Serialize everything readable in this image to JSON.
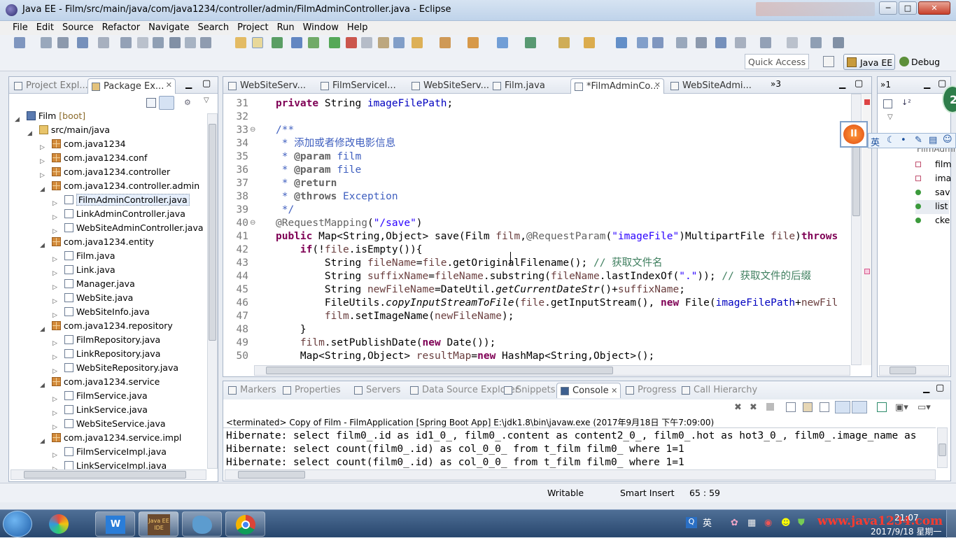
{
  "window": {
    "title": "Java EE - Film/src/main/java/com/java1234/controller/admin/FilmAdminController.java - Eclipse",
    "min": "─",
    "max": "□",
    "close": "✕"
  },
  "menu": [
    "File",
    "Edit",
    "Source",
    "Refactor",
    "Navigate",
    "Search",
    "Project",
    "Run",
    "Window",
    "Help"
  ],
  "quick_access": "Quick Access",
  "perspectives": {
    "javaee": "Java EE",
    "debug": "Debug"
  },
  "left_tabs": {
    "project": "Project Expl...",
    "package": "Package Ex..."
  },
  "tree": [
    {
      "label": "Film",
      "suffix": " [boot]",
      "indent": 0,
      "type": "project"
    },
    {
      "label": "src/main/java",
      "indent": 1,
      "type": "folder"
    },
    {
      "label": "com.java1234",
      "indent": 2,
      "type": "pkg"
    },
    {
      "label": "com.java1234.conf",
      "indent": 2,
      "type": "pkg"
    },
    {
      "label": "com.java1234.controller",
      "indent": 2,
      "type": "pkg"
    },
    {
      "label": "com.java1234.controller.admin",
      "indent": 2,
      "type": "pkg",
      "open": true
    },
    {
      "label": "FilmAdminController.java",
      "indent": 3,
      "type": "java",
      "selected": true
    },
    {
      "label": "LinkAdminController.java",
      "indent": 3,
      "type": "java"
    },
    {
      "label": "WebSiteAdminController.java",
      "indent": 3,
      "type": "java"
    },
    {
      "label": "com.java1234.entity",
      "indent": 2,
      "type": "pkg",
      "open": true
    },
    {
      "label": "Film.java",
      "indent": 3,
      "type": "java"
    },
    {
      "label": "Link.java",
      "indent": 3,
      "type": "java"
    },
    {
      "label": "Manager.java",
      "indent": 3,
      "type": "java"
    },
    {
      "label": "WebSite.java",
      "indent": 3,
      "type": "java"
    },
    {
      "label": "WebSiteInfo.java",
      "indent": 3,
      "type": "java"
    },
    {
      "label": "com.java1234.repository",
      "indent": 2,
      "type": "pkg",
      "open": true
    },
    {
      "label": "FilmRepository.java",
      "indent": 3,
      "type": "java"
    },
    {
      "label": "LinkRepository.java",
      "indent": 3,
      "type": "java"
    },
    {
      "label": "WebSiteRepository.java",
      "indent": 3,
      "type": "java"
    },
    {
      "label": "com.java1234.service",
      "indent": 2,
      "type": "pkg",
      "open": true
    },
    {
      "label": "FilmService.java",
      "indent": 3,
      "type": "java"
    },
    {
      "label": "LinkService.java",
      "indent": 3,
      "type": "java"
    },
    {
      "label": "WebSiteService.java",
      "indent": 3,
      "type": "java"
    },
    {
      "label": "com.java1234.service.impl",
      "indent": 2,
      "type": "pkg",
      "open": true
    },
    {
      "label": "FilmServiceImpl.java",
      "indent": 3,
      "type": "java"
    },
    {
      "label": "LinkServiceImpl.java",
      "indent": 3,
      "type": "java"
    }
  ],
  "editor_tabs": [
    {
      "label": "WebSiteServ..."
    },
    {
      "label": "FilmServiceI..."
    },
    {
      "label": "WebSiteServ..."
    },
    {
      "label": "Film.java"
    },
    {
      "label": "*FilmAdminCo...",
      "active": true
    },
    {
      "label": "WebSiteAdmi..."
    }
  ],
  "editor_overflow": "»3",
  "code_lines": [
    {
      "n": "31",
      "t": "<span class='kw'>private</span> String <span class='fd'>imageFilePath</span>;",
      "x": 0
    },
    {
      "n": "32",
      "t": "",
      "x": 0
    },
    {
      "n": "33",
      "t": "<span class='cm'>/**</span>",
      "x": 0
    },
    {
      "n": "34",
      "t": "<span class='cm'> * 添加或者修改电影信息</span>",
      "x": 0
    },
    {
      "n": "35",
      "t": "<span class='cm'> * <b class='an'>@param</b> film</span>",
      "x": 0
    },
    {
      "n": "36",
      "t": "<span class='cm'> * <b class='an'>@param</b> file</span>",
      "x": 0
    },
    {
      "n": "37",
      "t": "<span class='cm'> * <b class='an'>@return</b></span>",
      "x": 0
    },
    {
      "n": "38",
      "t": "<span class='cm'> * <b class='an'>@throws</b> Exception</span>",
      "x": 0
    },
    {
      "n": "39",
      "t": "<span class='cm'> */</span>",
      "x": 0
    },
    {
      "n": "40",
      "t": "<span class='an'>@RequestMapping</span>(<span class='st'>\"/save\"</span>)",
      "x": 0
    },
    {
      "n": "41",
      "t": "<span class='kw'>public</span> Map&lt;String,Object&gt; save(Film <span class='vr'>film</span>,<span class='an'>@RequestParam</span>(<span class='st'>\"imageFile\"</span>)MultipartFile <span class='vr'>file</span>)<span class='kw'>throws</span>",
      "x": 0
    },
    {
      "n": "42",
      "t": "    <span class='kw'>if</span>(!<span class='vr'>file</span>.isEmpty()){",
      "x": 0
    },
    {
      "n": "43",
      "t": "        String <span class='vr'>fileName</span>=<span class='vr'>file</span>.getOriginalFilename(); <span class='cz'>// 获取文件名</span>",
      "x": 0
    },
    {
      "n": "44",
      "t": "        String <span class='vr'>suffixName</span>=<span class='vr'>fileName</span>.substring(<span class='vr'>fileName</span>.lastIndexOf(<span class='st'>\".\"</span>)); <span class='cz'>// 获取文件的后缀</span>",
      "x": 0
    },
    {
      "n": "45",
      "t": "        String <span class='vr'>newFileName</span>=DateUtil.<i>getCurrentDateStr</i>()+<span class='vr'>suffixName</span>;",
      "x": 0
    },
    {
      "n": "46",
      "t": "        FileUtils.<i>copyInputStreamToFile</i>(<span class='vr'>file</span>.getInputStream(), <span class='kw'>new</span> File(<span class='fd'>imageFilePath</span>+<span class='vr'>newFil</span>",
      "x": 0
    },
    {
      "n": "47",
      "t": "        <span class='vr'>film</span>.setImageName(<span class='vr'>newFileName</span>);",
      "x": 0
    },
    {
      "n": "48",
      "t": "    }",
      "x": 0
    },
    {
      "n": "49",
      "t": "    <span class='vr'>film</span>.setPublishDate(<span class='kw'>new</span> Date());",
      "x": 0
    },
    {
      "n": "50",
      "t": "    Map&lt;String,Object&gt; <span class='vr'>resultMap</span>=<span class='kw'>new</span> HashMap&lt;String,Object&gt;();",
      "x": 0
    }
  ],
  "outline": {
    "tab": "»1",
    "items": [
      "film",
      "ima",
      "sav",
      "list",
      "cke"
    ],
    "root": "FilmAdmi"
  },
  "bottom_tabs": [
    "Markers",
    "Properties",
    "Servers",
    "Data Source Explorer",
    "Snippets",
    "Console",
    "Progress",
    "Call Hierarchy"
  ],
  "console": {
    "header": "<terminated> Copy of Film - FilmApplication [Spring Boot App] E:\\jdk1.8\\bin\\javaw.exe (2017年9月18日 下午7:09:00)",
    "lines": [
      "Hibernate: select film0_.id as id1_0_, film0_.content as content2_0_, film0_.hot as hot3_0_, film0_.image_name as",
      "Hibernate: select count(film0_.id) as col_0_0_ from t_film film0_ where 1=1",
      "Hibernate: select count(film0_.id) as col_0_0_ from t_film film0_ where 1=1"
    ]
  },
  "status": {
    "writable": "Writable",
    "insert": "Smart Insert",
    "position": "65 : 59"
  },
  "ime": {
    "lang": "英",
    "tray_lang": "英"
  },
  "clock": {
    "time": "21:07",
    "date": "2017/9/18 星期一"
  },
  "watermark": "www.java1234.com",
  "taskbar_app": "Java EE IDE",
  "badge": "2",
  "colors": {
    "accent": "#3875d7",
    "titlebar": "#c9daef",
    "taskbar": "#35547c"
  }
}
